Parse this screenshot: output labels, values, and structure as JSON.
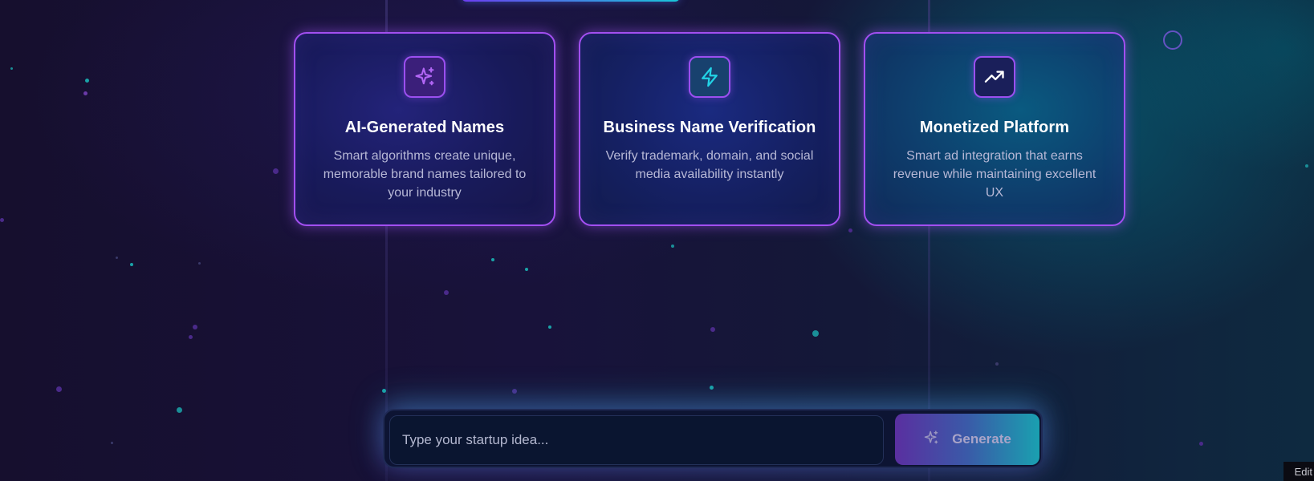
{
  "colors": {
    "card_border": "#a24ff0",
    "accent_purple": "#9b4ff0",
    "accent_cyan": "#18c7d8",
    "title_text": "#ffffff",
    "desc_text": "#b7b8d6"
  },
  "features": [
    {
      "icon": "sparkles-icon",
      "title": "AI-Generated Names",
      "description": "Smart algorithms create unique, memorable brand names tailored to your industry"
    },
    {
      "icon": "lightning-icon",
      "title": "Business Name Verification",
      "description": "Verify trademark, domain, and social media availability instantly"
    },
    {
      "icon": "trending-up-icon",
      "title": "Monetized Platform",
      "description": "Smart ad integration that earns revenue while maintaining excellent UX"
    }
  ],
  "search": {
    "placeholder": "Type your startup idea...",
    "value": "",
    "button_label": "Generate",
    "button_icon": "sparkles-icon"
  },
  "edit_tag": "Edit"
}
